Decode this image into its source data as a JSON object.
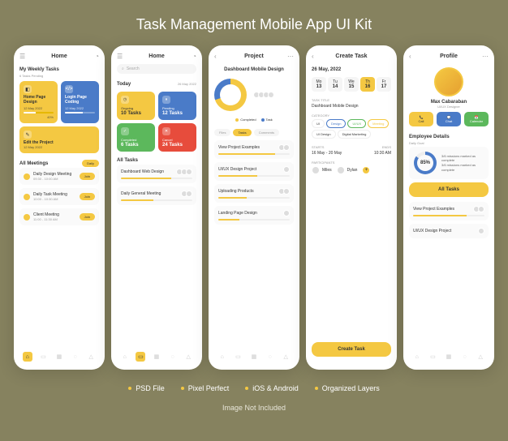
{
  "title": "Task Management Mobile App UI Kit",
  "features": [
    "PSD File",
    "Pixel Perfect",
    "iOS & Android",
    "Organized Layers"
  ],
  "disclaimer": "Image Not Included",
  "s1": {
    "title": "Home",
    "weekly": "My Weekly Tasks",
    "pending": "6 Tasks Pending",
    "card1": {
      "title": "Home Page Design",
      "sub": "12 May 2022",
      "pct": "40%"
    },
    "card2": {
      "title": "Login Page Coding",
      "sub": "12 May 2022"
    },
    "card3": {
      "title": "Edit the Project",
      "sub": "12 May 2022"
    },
    "meetings": "All Meetings",
    "daily": "Daily",
    "m1": {
      "name": "Daily Design Meeting",
      "time": "09:30 - 10:00 AM"
    },
    "m2": {
      "name": "Daily Task Meeting",
      "time": "10:00 - 10:30 AM"
    },
    "m3": {
      "name": "Client Meeting",
      "time": "11:00 - 11:30 AM"
    },
    "join": "Join"
  },
  "s2": {
    "title": "Home",
    "search": "Search",
    "today": "Today",
    "date": "26 May 2022",
    "st1": {
      "l": "Ongoing",
      "n": "10 Tasks"
    },
    "st2": {
      "l": "Pending",
      "n": "12 Tasks"
    },
    "st3": {
      "l": "Completed",
      "n": "6 Tasks"
    },
    "st4": {
      "l": "Cancel",
      "n": "24 Tasks"
    },
    "all": "All Tasks",
    "t1": "Dashboard Web Design",
    "t2": "Daily General Meeting"
  },
  "s3": {
    "title": "Project",
    "proj": "Dashboard Mobile Design",
    "leg1": "Completed",
    "leg2": "Task",
    "tabs": [
      "Files",
      "Tasks",
      "Comments"
    ],
    "t1": "View Project Examples",
    "t2": "UI/UX Design Project",
    "t3": "Uploading Products",
    "t4": "Landing Page Design"
  },
  "s4": {
    "title": "Create Task",
    "date": "26 May, 2022",
    "days": [
      {
        "d": "Mo",
        "n": "13"
      },
      {
        "d": "Tu",
        "n": "14"
      },
      {
        "d": "We",
        "n": "15"
      },
      {
        "d": "Th",
        "n": "16"
      },
      {
        "d": "Fr",
        "n": "17"
      }
    ],
    "l_title": "TASK TITLE",
    "v_title": "Dashboard Mobile Design",
    "l_cat": "CATEGORY",
    "cats": [
      "UI",
      "Design",
      "UI/UX",
      "Meeting",
      "UI Design",
      "Digital Marketing"
    ],
    "l_starts": "STARTS",
    "l_ends": "ENDS",
    "v_dates": "16 May - 20 May",
    "v_time": "10:30 AM",
    "l_part": "PARTICIPANTS",
    "p1": "Miles",
    "p2": "Dylan",
    "add": "+",
    "cta": "Create Task"
  },
  "s5": {
    "title": "Profile",
    "name": "Max Cabaraban",
    "role": "UI/UX Designer",
    "a1": "Call",
    "a2": "Chat",
    "a3": "Calendar",
    "emp": "Employee Details",
    "goal": "Daily Goal",
    "pct": "85%",
    "g1": "3/6 missions marked as complete",
    "g2": "3/6 missions marked as complete",
    "all": "All Tasks",
    "t1": "View Project Examples",
    "t2": "UI/UX Design Project"
  }
}
